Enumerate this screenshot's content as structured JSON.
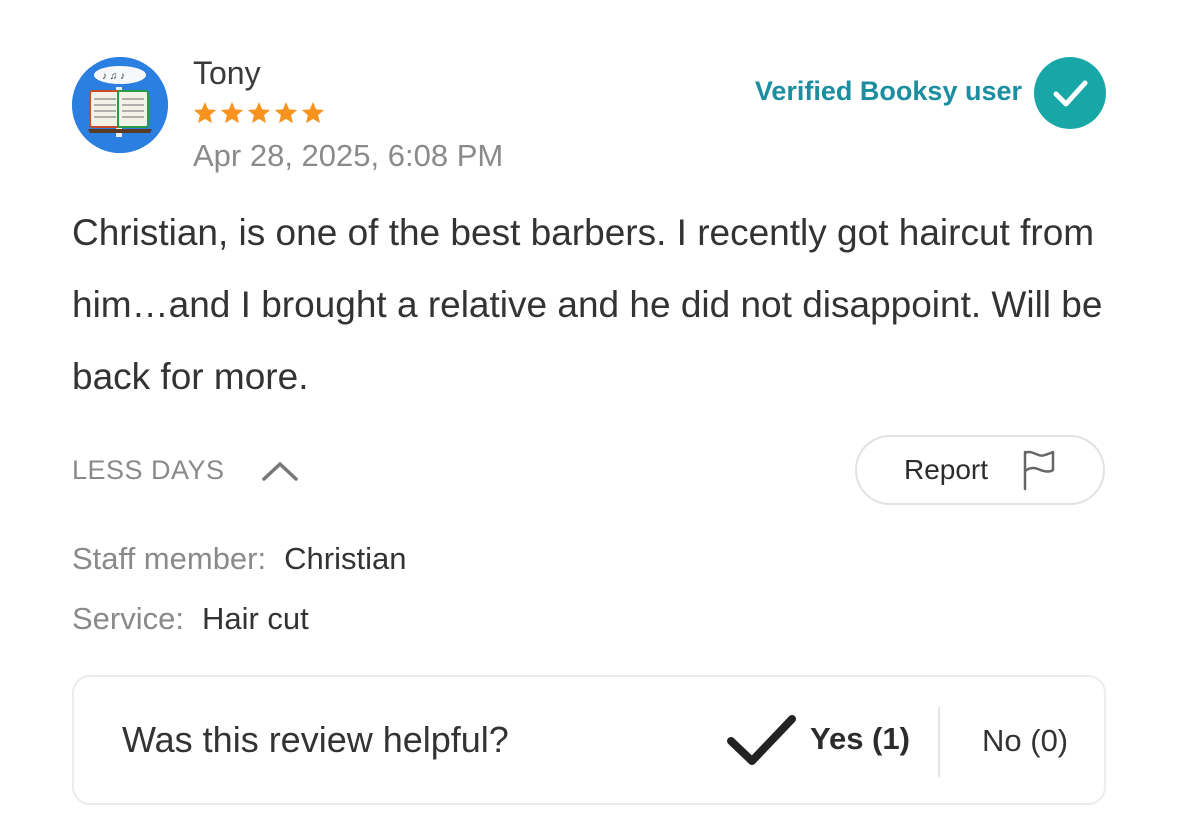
{
  "review": {
    "author": "Tony",
    "rating": 5,
    "date": "Apr 28, 2025, 6:08 PM",
    "verified_label": "Verified Booksy user",
    "text": "Christian, is one of the best barbers. I recently got haircut from him…and I brought a relative and he did not disappoint. Will be back for more.",
    "toggle_label": "LESS DAYS",
    "report_label": "Report",
    "details": {
      "staff_key": "Staff member:",
      "staff_value": "Christian",
      "service_key": "Service:",
      "service_value": "Hair cut"
    }
  },
  "helpful": {
    "question": "Was this review helpful?",
    "yes_label": "Yes (1)",
    "no_label": "No (0)"
  },
  "colors": {
    "star": "#f7931e",
    "verified": "#18a7a7",
    "verified_text": "#1b8ea0"
  },
  "icons": {
    "avatar": "music-book-avatar",
    "verified": "check-circle-icon",
    "collapse": "chevron-up-icon",
    "report": "flag-icon",
    "yes": "checkmark-icon"
  }
}
